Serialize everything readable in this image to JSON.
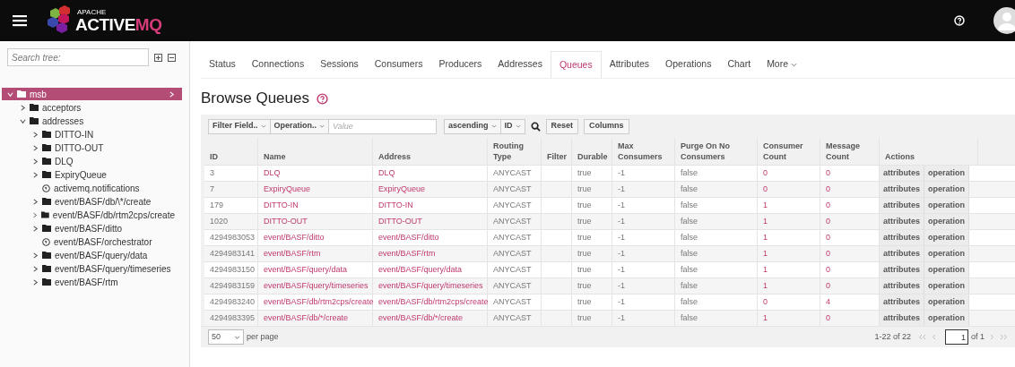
{
  "header": {
    "logo": {
      "top": "APACHE",
      "main": "ACTIVE",
      "accent": "MQ"
    }
  },
  "sidebar": {
    "search": {
      "placeholder": "Search tree:"
    },
    "tree": [
      {
        "label": "msb",
        "kind": "folder",
        "expanded": true,
        "selected": true,
        "children": [
          {
            "label": "acceptors",
            "kind": "folder",
            "expanded": false,
            "selected": false
          },
          {
            "label": "addresses",
            "kind": "folder",
            "expanded": true,
            "selected": false,
            "children": [
              {
                "label": "DITTO-IN",
                "kind": "folder",
                "expanded": false,
                "selected": false
              },
              {
                "label": "DITTO-OUT",
                "kind": "folder",
                "expanded": false,
                "selected": false
              },
              {
                "label": "DLQ",
                "kind": "folder",
                "expanded": false,
                "selected": false
              },
              {
                "label": "ExpiryQueue",
                "kind": "folder",
                "expanded": false,
                "selected": false
              },
              {
                "label": "activemq.notifications",
                "kind": "topic",
                "selected": false
              },
              {
                "label": "event/BASF/db/\\*/create",
                "kind": "folder",
                "expanded": false,
                "selected": false
              },
              {
                "label": "event/BASF/db/rtm2cps/create",
                "kind": "folder",
                "expanded": false,
                "selected": false
              },
              {
                "label": "event/BASF/ditto",
                "kind": "folder",
                "expanded": false,
                "selected": false
              },
              {
                "label": "event/BASF/orchestrator",
                "kind": "topic",
                "selected": false
              },
              {
                "label": "event/BASF/query/data",
                "kind": "folder",
                "expanded": false,
                "selected": false
              },
              {
                "label": "event/BASF/query/timeseries",
                "kind": "folder",
                "expanded": false,
                "selected": false
              },
              {
                "label": "event/BASF/rtm",
                "kind": "folder",
                "expanded": false,
                "selected": false
              }
            ]
          }
        ]
      }
    ]
  },
  "tabs": [
    {
      "label": "Status",
      "selected": false
    },
    {
      "label": "Connections",
      "selected": false
    },
    {
      "label": "Sessions",
      "selected": false
    },
    {
      "label": "Consumers",
      "selected": false
    },
    {
      "label": "Producers",
      "selected": false
    },
    {
      "label": "Addresses",
      "selected": false
    },
    {
      "label": "Queues",
      "selected": true
    },
    {
      "label": "Attributes",
      "selected": false
    },
    {
      "label": "Operations",
      "selected": false
    },
    {
      "label": "Chart",
      "selected": false
    },
    {
      "label": "More",
      "selected": false,
      "dropdown": true
    }
  ],
  "title": "Browse Queues",
  "toolbar": {
    "filter_field": "Filter Field..",
    "operation": "Operation..",
    "value_placeholder": "Value",
    "order": "ascending",
    "sort_by": "ID",
    "reset": "Reset",
    "columns": "Columns"
  },
  "table": {
    "columns": [
      [
        "ID"
      ],
      [
        "Name"
      ],
      [
        "Address"
      ],
      [
        "Routing",
        "Type"
      ],
      [
        "Filter"
      ],
      [
        "Durable"
      ],
      [
        "Max",
        "Consumers"
      ],
      [
        "Purge On No",
        "Consumers"
      ],
      [
        "Consumer",
        "Count"
      ],
      [
        "Message",
        "Count"
      ],
      [
        "Actions"
      ]
    ],
    "rows": [
      {
        "id": "3",
        "name": "DLQ",
        "address": "DLQ",
        "routing_type": "ANYCAST",
        "durable": "true",
        "max_consumers": "-1",
        "purge": "false",
        "consumer_count": "0",
        "message_count": "0",
        "actions": [
          "attributes",
          "operation"
        ]
      },
      {
        "id": "7",
        "name": "ExpiryQueue",
        "address": "ExpiryQueue",
        "routing_type": "ANYCAST",
        "durable": "true",
        "max_consumers": "-1",
        "purge": "false",
        "consumer_count": "0",
        "message_count": "0",
        "actions": [
          "attributes",
          "operation"
        ]
      },
      {
        "id": "179",
        "name": "DITTO-IN",
        "address": "DITTO-IN",
        "routing_type": "ANYCAST",
        "durable": "true",
        "max_consumers": "-1",
        "purge": "false",
        "consumer_count": "1",
        "message_count": "0",
        "actions": [
          "attributes",
          "operation"
        ]
      },
      {
        "id": "1020",
        "name": "DITTO-OUT",
        "address": "DITTO-OUT",
        "routing_type": "ANYCAST",
        "durable": "true",
        "max_consumers": "-1",
        "purge": "false",
        "consumer_count": "1",
        "message_count": "0",
        "actions": [
          "attributes",
          "operation"
        ]
      },
      {
        "id": "4294983053",
        "name": "event/BASF/ditto",
        "address": "event/BASF/ditto",
        "routing_type": "ANYCAST",
        "durable": "true",
        "max_consumers": "-1",
        "purge": "false",
        "consumer_count": "1",
        "message_count": "0",
        "actions": [
          "attributes",
          "operation"
        ]
      },
      {
        "id": "4294983141",
        "name": "event/BASF/rtm",
        "address": "event/BASF/rtm",
        "routing_type": "ANYCAST",
        "durable": "true",
        "max_consumers": "-1",
        "purge": "false",
        "consumer_count": "1",
        "message_count": "0",
        "actions": [
          "attributes",
          "operation"
        ]
      },
      {
        "id": "4294983150",
        "name": "event/BASF/query/data",
        "address": "event/BASF/query/data",
        "routing_type": "ANYCAST",
        "durable": "true",
        "max_consumers": "-1",
        "purge": "false",
        "consumer_count": "1",
        "message_count": "0",
        "actions": [
          "attributes",
          "operation"
        ]
      },
      {
        "id": "4294983159",
        "name": "event/BASF/query/timeseries",
        "address": "event/BASF/query/timeseries",
        "routing_type": "ANYCAST",
        "durable": "true",
        "max_consumers": "-1",
        "purge": "false",
        "consumer_count": "1",
        "message_count": "0",
        "actions": [
          "attributes",
          "operation"
        ]
      },
      {
        "id": "4294983240",
        "name": "event/BASF/db/rtm2cps/create",
        "address": "event/BASF/db/rtm2cps/create",
        "routing_type": "ANYCAST",
        "durable": "true",
        "max_consumers": "-1",
        "purge": "false",
        "consumer_count": "0",
        "message_count": "4",
        "actions": [
          "attributes",
          "operation"
        ]
      },
      {
        "id": "4294983395",
        "name": "event/BASF/db/*/create",
        "address": "event/BASF/db/*/create",
        "routing_type": "ANYCAST",
        "durable": "true",
        "max_consumers": "-1",
        "purge": "false",
        "consumer_count": "1",
        "message_count": "0",
        "actions": [
          "attributes",
          "operation"
        ]
      }
    ]
  },
  "pagination": {
    "page_size": "50",
    "per_page": "per page",
    "range": "1-22 of 22",
    "page": "1",
    "of": "of 1",
    "first_disabled": true,
    "prev_disabled": true,
    "next_disabled": true,
    "last_disabled": true
  }
}
